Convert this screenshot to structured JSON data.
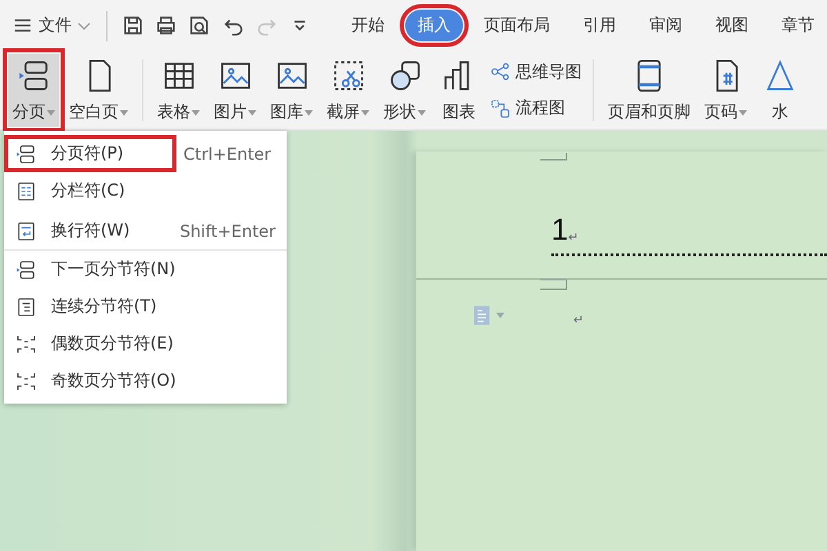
{
  "toolbar": {
    "menu_label": "文件",
    "items": [
      {
        "kind": "save",
        "disabled": false
      },
      {
        "kind": "print",
        "disabled": false
      },
      {
        "kind": "preview",
        "disabled": false
      },
      {
        "kind": "undo",
        "disabled": false
      },
      {
        "kind": "redo",
        "disabled": true
      },
      {
        "kind": "more",
        "disabled": false
      }
    ]
  },
  "tabs": [
    {
      "label": "开始",
      "selected": false,
      "annotated": false
    },
    {
      "label": "插入",
      "selected": true,
      "annotated": true
    },
    {
      "label": "页面布局",
      "selected": false,
      "annotated": false
    },
    {
      "label": "引用",
      "selected": false,
      "annotated": false
    },
    {
      "label": "审阅",
      "selected": false,
      "annotated": false
    },
    {
      "label": "视图",
      "selected": false,
      "annotated": false
    },
    {
      "label": "章节",
      "selected": false,
      "annotated": false
    }
  ],
  "ribbon": {
    "groups": [
      [
        {
          "kind": "large",
          "label": "分页",
          "dropdown": true,
          "pressed": true,
          "annotated": true
        },
        {
          "kind": "large",
          "label": "空白页",
          "dropdown": true,
          "pressed": false,
          "annotated": false
        }
      ],
      [
        {
          "kind": "large",
          "label": "表格",
          "dropdown": true,
          "pressed": false,
          "annotated": false
        },
        {
          "kind": "large",
          "label": "图片",
          "dropdown": true,
          "pressed": false,
          "annotated": false
        },
        {
          "kind": "large",
          "label": "图库",
          "dropdown": true,
          "pressed": false,
          "annotated": false
        },
        {
          "kind": "large",
          "label": "截屏",
          "dropdown": true,
          "pressed": false,
          "annotated": false
        },
        {
          "kind": "large",
          "label": "形状",
          "dropdown": true,
          "pressed": false,
          "annotated": false
        },
        {
          "kind": "large",
          "label": "图表",
          "dropdown": false,
          "pressed": false,
          "annotated": false
        },
        {
          "kind": "stack",
          "items": [
            {
              "label": "思维导图"
            },
            {
              "label": "流程图"
            }
          ]
        }
      ],
      [
        {
          "kind": "large",
          "label": "页眉和页脚",
          "dropdown": false,
          "pressed": false,
          "annotated": false
        },
        {
          "kind": "large",
          "label": "页码",
          "dropdown": true,
          "pressed": false,
          "annotated": false
        },
        {
          "kind": "large",
          "label": "水",
          "dropdown": false,
          "pressed": false,
          "annotated": false
        }
      ]
    ]
  },
  "menu": {
    "items": [
      {
        "label": "分页符(P)",
        "shortcut": "Ctrl+Enter",
        "annotated": true,
        "separator_after": false
      },
      {
        "label": "分栏符(C)",
        "annotated": false,
        "separator_after": false
      },
      {
        "label": "换行符(W)",
        "shortcut": "Shift+Enter",
        "annotated": false,
        "separator_after": true
      },
      {
        "label": "下一页分节符(N)",
        "annotated": false,
        "separator_after": false
      },
      {
        "label": "连续分节符(T)",
        "annotated": false,
        "separator_after": false
      },
      {
        "label": "偶数页分节符(E)",
        "annotated": false,
        "separator_after": false
      },
      {
        "label": "奇数页分节符(O)",
        "annotated": false,
        "separator_after": false
      }
    ]
  },
  "document": {
    "first_page_text": "1",
    "first_page_mark": "↵",
    "second_page_mark": "↵"
  }
}
